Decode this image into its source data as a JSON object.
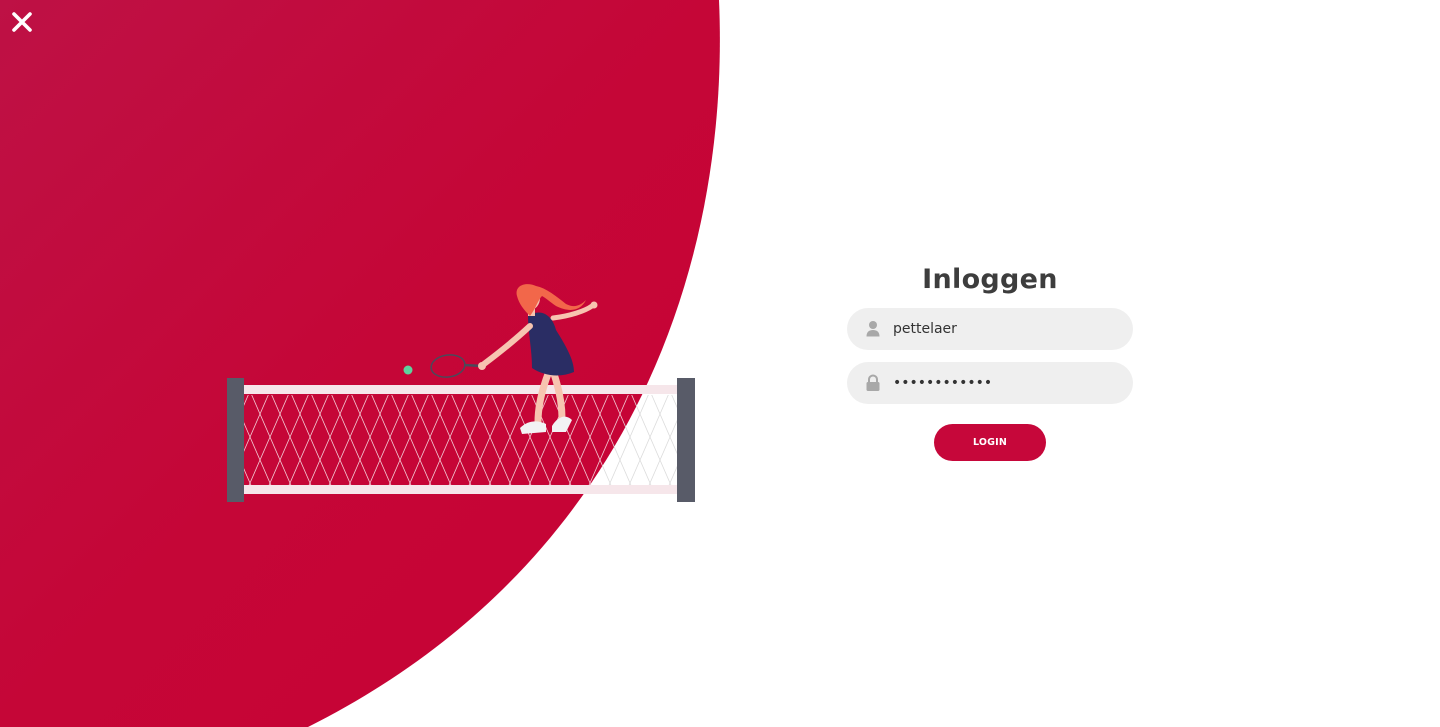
{
  "colors": {
    "accent": "#c6073a",
    "accent_dark": "#b91245",
    "field_bg": "#efefef",
    "title": "#3d3d3d"
  },
  "close": {
    "icon": "close-icon"
  },
  "login": {
    "title": "Inloggen",
    "username": {
      "value": "pettelaer",
      "icon": "user-icon"
    },
    "password": {
      "value": "••••••••••••",
      "icon": "lock-icon"
    },
    "button_label": "LOGIN"
  }
}
